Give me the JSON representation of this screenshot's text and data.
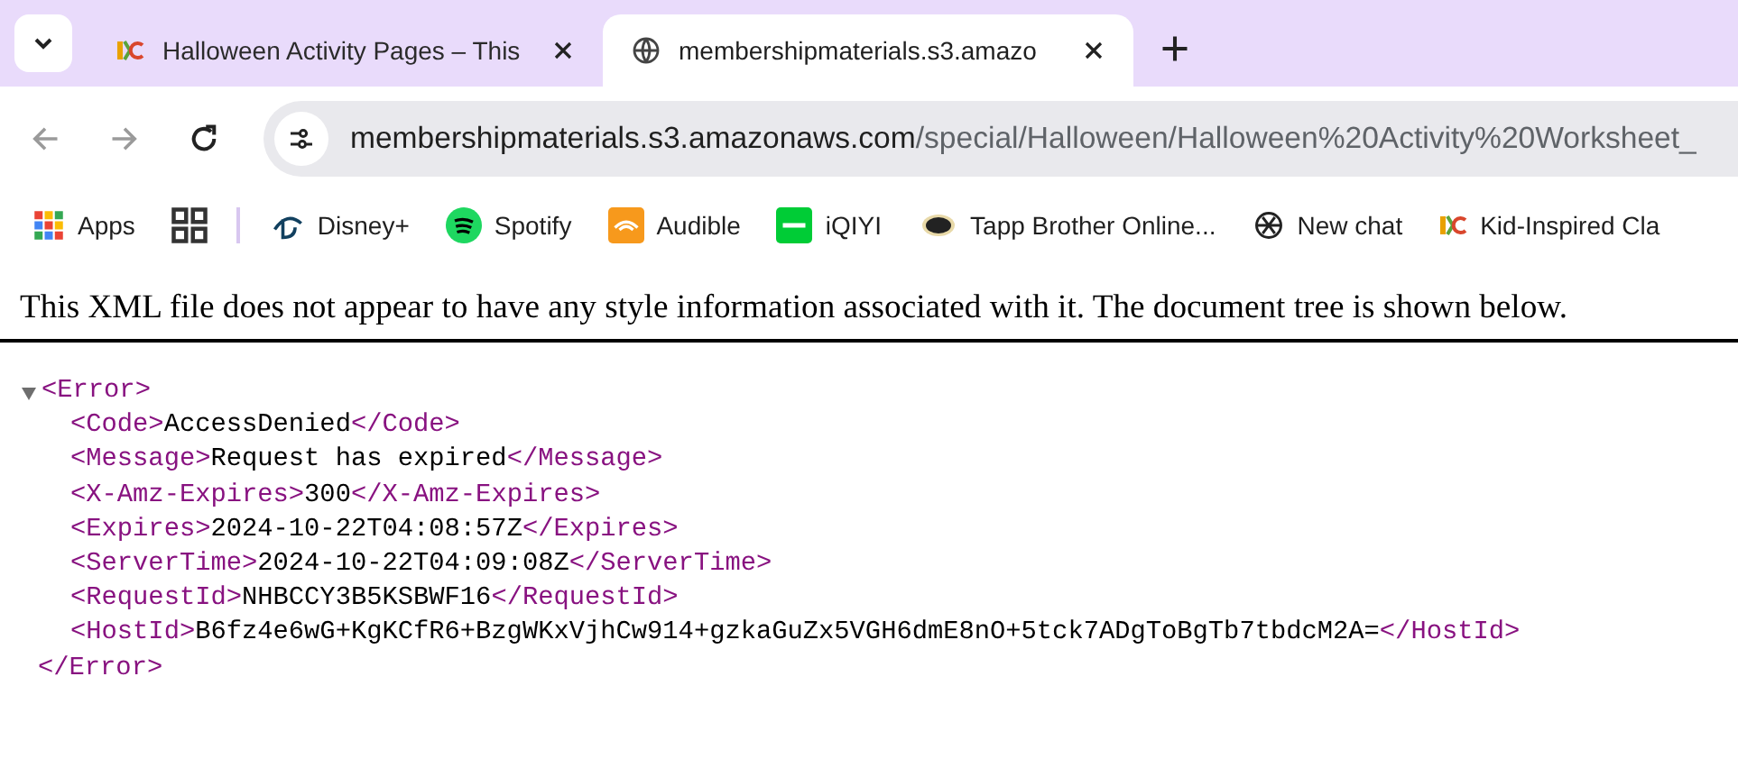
{
  "tabs": [
    {
      "title": "Halloween Activity Pages – This",
      "selected": false
    },
    {
      "title": "membershipmaterials.s3.amazo",
      "selected": true
    }
  ],
  "address_bar": {
    "domain": "membershipmaterials.s3.amazonaws.com",
    "path": "/special/Halloween/Halloween%20Activity%20Worksheet_"
  },
  "bookmarks": [
    {
      "label": "Apps"
    },
    {
      "label": "Disney+"
    },
    {
      "label": "Spotify"
    },
    {
      "label": "Audible"
    },
    {
      "label": "iQIYI"
    },
    {
      "label": "Tapp Brother Online..."
    },
    {
      "label": "New chat"
    },
    {
      "label": "Kid-Inspired Cla"
    }
  ],
  "notice": "This XML file does not appear to have any style information associated with it. The document tree is shown below.",
  "xml": {
    "open": "<Error>",
    "close": "</Error>",
    "expanded": true,
    "children": [
      {
        "open": "<Code>",
        "value": "AccessDenied",
        "close": "</Code>"
      },
      {
        "open": "<Message>",
        "value": "Request has expired",
        "close": "</Message>"
      },
      {
        "open": "<X-Amz-Expires>",
        "value": "300",
        "close": "</X-Amz-Expires>"
      },
      {
        "open": "<Expires>",
        "value": "2024-10-22T04:08:57Z",
        "close": "</Expires>"
      },
      {
        "open": "<ServerTime>",
        "value": "2024-10-22T04:09:08Z",
        "close": "</ServerTime>"
      },
      {
        "open": "<RequestId>",
        "value": "NHBCCY3B5KSBWF16",
        "close": "</RequestId>"
      },
      {
        "open": "<HostId>",
        "value": "B6fz4e6wG+KgKCfR6+BzgWKxVjhCw914+gzkaGuZx5VGH6dmE8nO+5tck7ADgToBgTb7tbdcM2A=",
        "close": "</HostId>"
      }
    ]
  }
}
